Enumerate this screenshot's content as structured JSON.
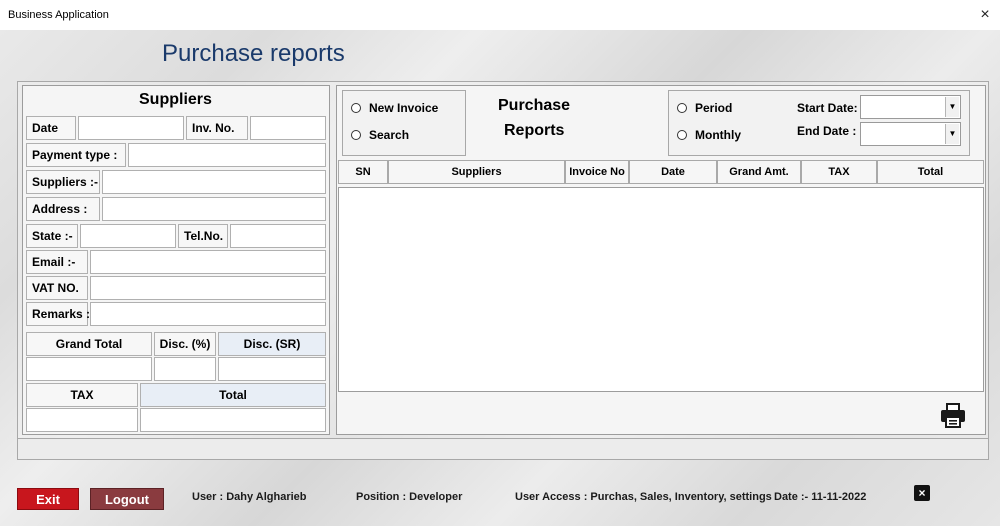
{
  "window": {
    "title": "Business Application",
    "close_glyph": "×"
  },
  "page": {
    "heading": "Purchase reports"
  },
  "suppliers_form": {
    "title": "Suppliers",
    "labels": {
      "date": "Date",
      "inv_no": "Inv. No.",
      "payment_type": "Payment type :",
      "suppliers": "Suppliers :-",
      "address": "Address :",
      "state": "State :-",
      "tel_no": "Tel.No.",
      "email": "Email :-",
      "vat_no": "VAT NO.",
      "remarks": "Remarks :",
      "grand_total": "Grand Total",
      "disc_pct": "Disc. (%)",
      "disc_sr": "Disc. (SR)",
      "tax": "TAX",
      "total": "Total"
    },
    "values": {
      "date": "",
      "inv_no": "",
      "payment_type": "",
      "suppliers": "",
      "address": "",
      "state": "",
      "tel_no": "",
      "email": "",
      "vat_no": "",
      "remarks": "",
      "grand_total": "",
      "disc_pct": "",
      "disc_sr": "",
      "tax": "",
      "total": ""
    }
  },
  "reports": {
    "mode_options": {
      "new_invoice": "New Invoice",
      "search": "Search"
    },
    "title_line1": "Purchase",
    "title_line2": "Reports",
    "period_options": {
      "period": "Period",
      "monthly": "Monthly"
    },
    "start_date_label": "Start Date:",
    "end_date_label": "End Date :",
    "start_date_value": "",
    "end_date_value": "",
    "dropdown_glyph": "▼",
    "columns": [
      "SN",
      "Suppliers",
      "Invoice No",
      "Date",
      "Grand Amt.",
      "TAX",
      "Total"
    ],
    "rows": []
  },
  "footer": {
    "exit_label": "Exit",
    "logout_label": "Logout",
    "user": "User : Dahy Algharieb",
    "position": "Position : Developer",
    "user_access": "User Access : Purchas, Sales, Inventory, settings",
    "date": "Date  :-  11-11-2022",
    "close_glyph": "×"
  },
  "colors": {
    "heading": "#1a3a6b",
    "exit_button": "#c8161d",
    "logout_button": "#8a3b3f"
  },
  "icons": [
    "close-icon",
    "printer-icon",
    "dropdown-arrow-icon",
    "close-square-icon"
  ]
}
